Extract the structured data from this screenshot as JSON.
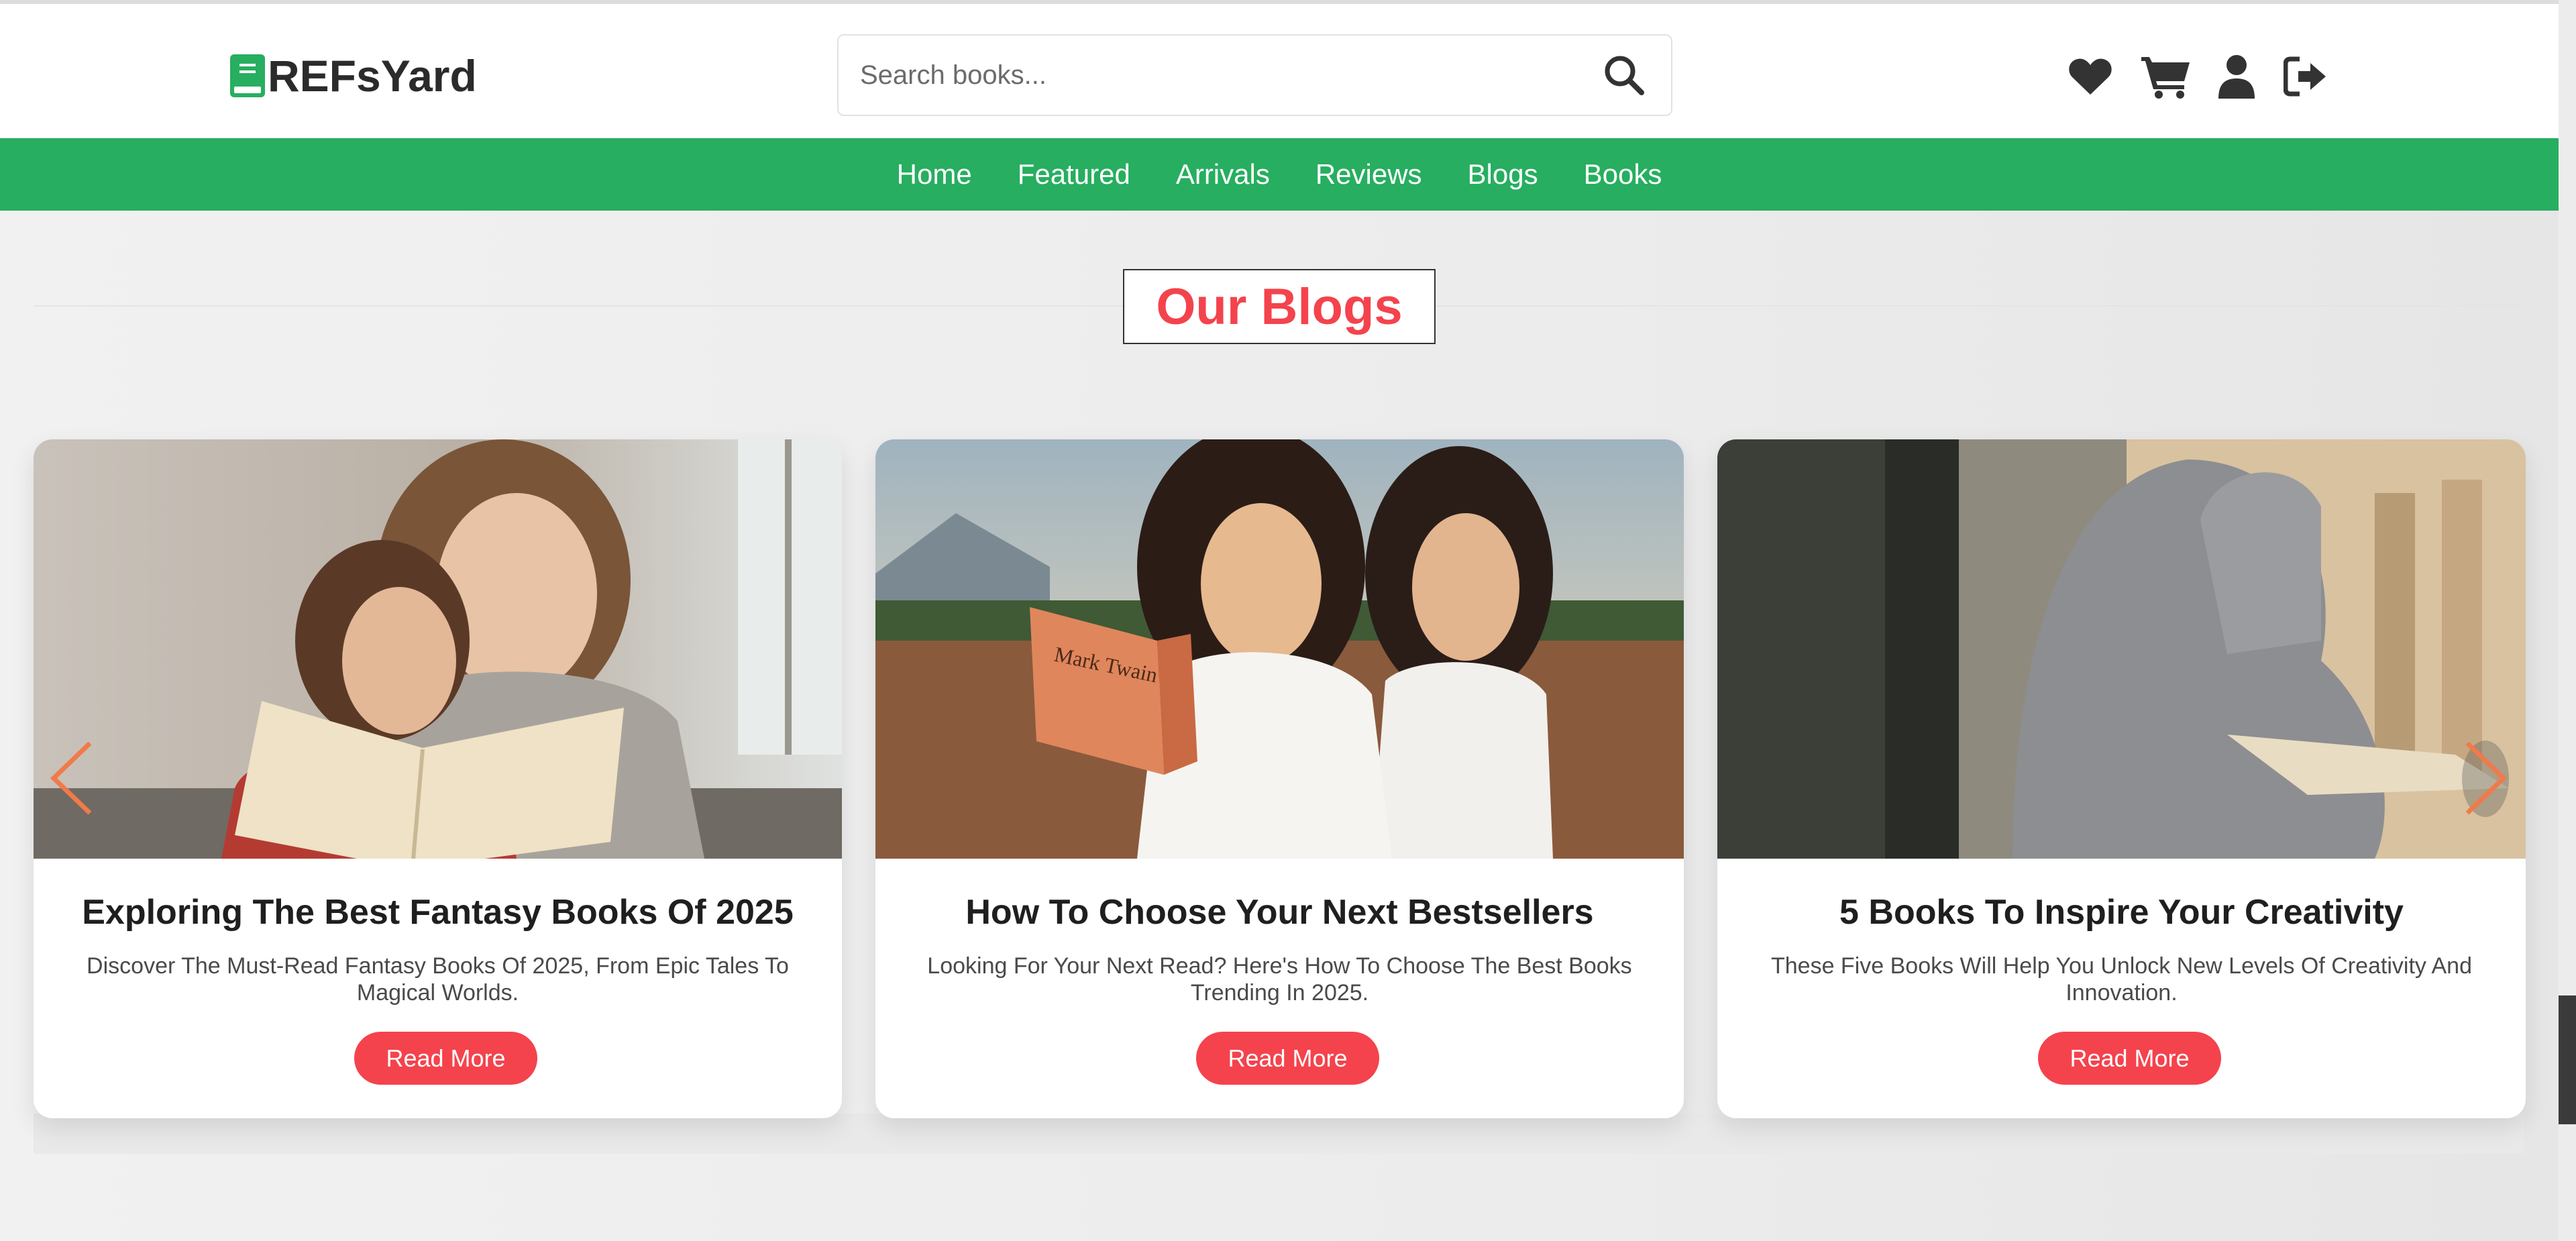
{
  "brand": {
    "name": "REFsYard",
    "accent": "#27ae60"
  },
  "search": {
    "placeholder": "Search books..."
  },
  "header_icons": [
    "heart-icon",
    "cart-icon",
    "user-icon",
    "logout-icon"
  ],
  "nav": {
    "items": [
      "Home",
      "Featured",
      "Arrivals",
      "Reviews",
      "Blogs",
      "Books"
    ]
  },
  "section": {
    "title": "Our Blogs",
    "title_color": "#f4434d"
  },
  "blogs": [
    {
      "title": "Exploring The Best Fantasy Books Of 2025",
      "description": "Discover The Must-Read Fantasy Books Of 2025, From Epic Tales To Magical Worlds.",
      "button": "Read More",
      "image": "mother-and-daughter-reading-photo"
    },
    {
      "title": "How To Choose Your Next Bestsellers",
      "description": "Looking For Your Next Read? Here's How To Choose The Best Books Trending In 2025.",
      "button": "Read More",
      "image": "two-women-reading-outdoors-photo",
      "book_text": "Mark Twain"
    },
    {
      "title": "5 Books To Inspire Your Creativity",
      "description": "These Five Books Will Help You Unlock New Levels Of Creativity And Innovation.",
      "button": "Read More",
      "image": "woman-in-hijab-reading-photo"
    }
  ],
  "carousel": {
    "prev": "chevron-left-icon",
    "next": "chevron-right-icon",
    "arrow_color": "#f07a4a"
  },
  "button_color": "#f4434d"
}
